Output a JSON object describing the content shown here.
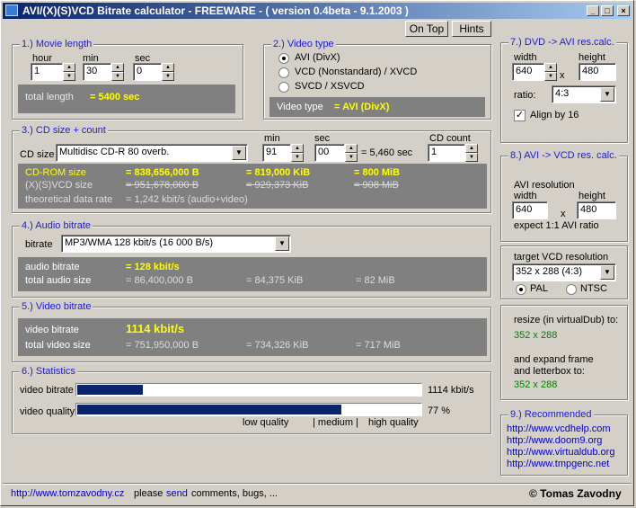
{
  "title": "AVI/(X)(S)VCD Bitrate calculator  - FREEWARE -  ( version 0.4beta - 9.1.2003 )",
  "window_buttons": {
    "minimize": "_",
    "maximize": "□",
    "close": "×"
  },
  "toolbar": {
    "on_top": "On Top",
    "hints": "Hints"
  },
  "movie": {
    "legend": "1.) Movie length",
    "hour_label": "hour",
    "hour": "1",
    "min_label": "min",
    "min": "30",
    "sec_label": "sec",
    "sec": "0",
    "total_label": "total length",
    "total_value": "= 5400 sec"
  },
  "video_type": {
    "legend": "2.) Video type",
    "options": [
      "AVI (DivX)",
      "VCD (Nonstandard) / XVCD",
      "SVCD / XSVCD"
    ],
    "label": "Video type",
    "value": "= AVI (DivX)"
  },
  "cd": {
    "legend": "3.) CD size + count",
    "size_label": "CD size",
    "size": "Multidisc CD-R 80 overb.",
    "min_label": "min",
    "min": "91",
    "sec_label": "sec",
    "sec": "00",
    "secs_total": "= 5,460 sec",
    "count_label": "CD count",
    "count": "1",
    "rom_label": "CD-ROM size",
    "rom_b": "= 838,656,000 B",
    "rom_kib": "= 819,000 KiB",
    "rom_mib": "= 800 MiB",
    "vcd_label": "(X)(S)VCD size",
    "vcd_b": "= 951,678,000 B",
    "vcd_kib": "= 929,373 KiB",
    "vcd_mib": "= 908 MiB",
    "rate_label": "theoretical data rate",
    "rate_value": "= 1,242 kbit/s (audio+video)"
  },
  "audio": {
    "legend": "4.) Audio bitrate",
    "bitrate_label": "bitrate",
    "bitrate": "MP3/WMA 128 kbit/s (16 000 B/s)",
    "ab_label": "audio bitrate",
    "ab_value": "= 128 kbit/s",
    "size_label": "total audio size",
    "size_b": "= 86,400,000 B",
    "size_kib": "= 84,375 KiB",
    "size_mib": "= 82 MiB"
  },
  "video": {
    "legend": "5.) Video bitrate",
    "vb_label": "video bitrate",
    "vb_value": "1114 kbit/s",
    "size_label": "total video size",
    "size_b": "= 751,950,000 B",
    "size_kib": "= 734,326 KiB",
    "size_mib": "= 717 MiB"
  },
  "stats": {
    "legend": "6.) Statistics",
    "vb_label": "video bitrate",
    "vb_value": "1114 kbit/s",
    "vb_fill": 0.19,
    "vq_label": "video quality",
    "vq_value": "77 %",
    "vq_fill": 0.77,
    "low": "low quality",
    "medium": "| medium |",
    "high": "high quality"
  },
  "dvd": {
    "legend": "7.) DVD -> AVI res.calc.",
    "width_label": "width",
    "width": "640",
    "x": "x",
    "height_label": "height",
    "height": "480",
    "ratio_label": "ratio:",
    "ratio": "4:3",
    "align_label": "Align by 16"
  },
  "avivcd": {
    "legend": "8.) AVI -> VCD res. calc.",
    "res_label": "AVI resolution",
    "width_label": "width",
    "width": "640",
    "x": "x",
    "height_label": "height",
    "height": "480",
    "expect": "expect 1:1 AVI ratio"
  },
  "target": {
    "label": "target VCD resolution",
    "value": "352 x 288 (4:3)",
    "pal": "PAL",
    "ntsc": "NTSC"
  },
  "resize": {
    "label": "resize (in virtualDub) to:",
    "value": "352 x 288",
    "expand1": "and expand frame",
    "expand2": "and letterbox to:",
    "expand_value": "352 x 288"
  },
  "recommended": {
    "legend": "9.) Recommended",
    "links": [
      "http://www.vcdhelp.com",
      "http://www.doom9.org",
      "http://www.virtualdub.org",
      "http://www.tmpgenc.net"
    ]
  },
  "status": {
    "url": "http://www.tomzavodny.cz",
    "please": "please",
    "send": "send",
    "rest": "comments, bugs, ...",
    "author": "© Tomas Zavodny"
  }
}
